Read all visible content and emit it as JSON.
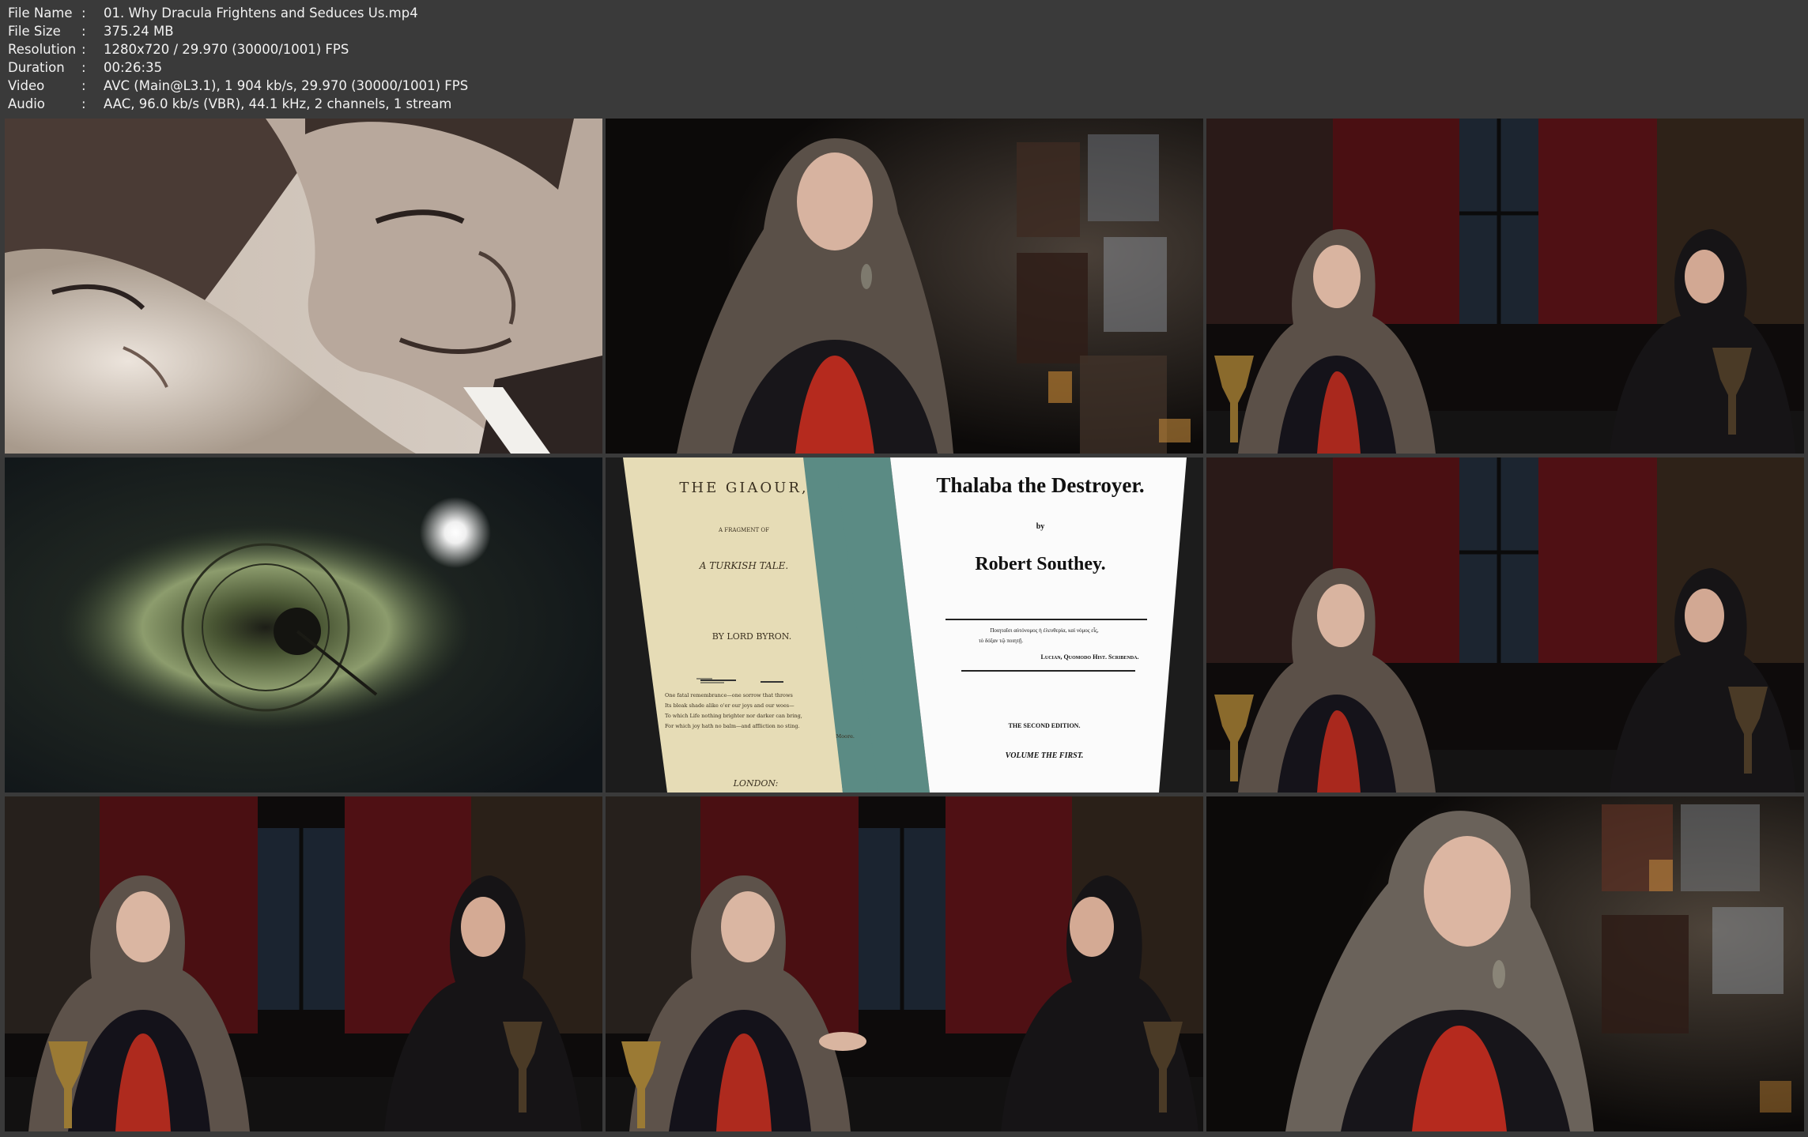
{
  "info": {
    "rows": [
      {
        "key": "File Name",
        "sep": ":",
        "value": "01. Why Dracula Frightens and Seduces Us.mp4"
      },
      {
        "key": "File Size",
        "sep": ":",
        "value": "375.24 MB"
      },
      {
        "key": "Resolution",
        "sep": ":",
        "value": "1280x720 / 29.970 (30000/1001) FPS"
      },
      {
        "key": "Duration",
        "sep": ":",
        "value": "00:26:35"
      },
      {
        "key": "Video",
        "sep": ":",
        "value": "AVC (Main@L3.1), 1 904 kb/s, 29.970 (30000/1001) FPS"
      },
      {
        "key": "Audio",
        "sep": ":",
        "value": "AAC, 96.0 kb/s (VBR), 44.1 kHz, 2 channels, 1 stream"
      }
    ]
  },
  "book_left": {
    "title": "THE GIAOUR,",
    "subtitle": "A FRAGMENT OF",
    "tale": "A TURKISH TALE.",
    "author": "BY LORD BYRON.",
    "quote_lines": [
      "One fatal remembrance—one sorrow that throws",
      "Its bleak shade alike o'er our joys and our woes—",
      "To which Life nothing brighter nor darker can bring,",
      "For which joy hath no balm—and affliction no sting."
    ],
    "quote_attr": "Moore.",
    "place": "LONDON:"
  },
  "book_right": {
    "title": "Thalaba the Destroyer.",
    "by": "by",
    "author": "Robert Southey.",
    "greek_line1": "Ποιηταῖσι αὐτόνομος ἡ ἐλευθερία, καὶ νόμος εἷς,",
    "greek_line2": "τὸ δόξαν τῷ ποιητῇ.",
    "cite": "Lucian, Quomodo Hist. Scribenda.",
    "edition": "THE SECOND EDITION.",
    "volume": "VOLUME THE FIRST."
  },
  "colors": {
    "background": "#3a3a3a",
    "parchment": "#e6dcb6",
    "teal_band": "#5b8b84",
    "dress_red": "#b52a1e"
  }
}
